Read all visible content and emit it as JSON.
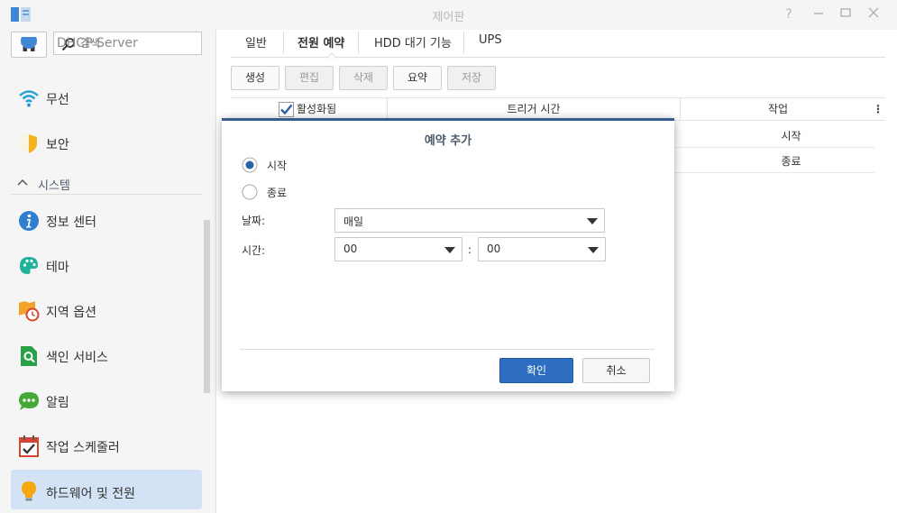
{
  "window": {
    "title": "제어판",
    "controls": [
      "help-icon",
      "minimize-icon",
      "maximize-icon",
      "close-icon"
    ]
  },
  "sidebar": {
    "search_placeholder": "검색",
    "cut_item_label": "DHCP Server",
    "items_top": [
      {
        "label": "무선",
        "icon": "wifi-icon"
      },
      {
        "label": "보안",
        "icon": "shield-icon"
      }
    ],
    "section_label": "시스템",
    "items": [
      {
        "label": "정보 센터",
        "icon": "info-icon"
      },
      {
        "label": "테마",
        "icon": "palette-icon"
      },
      {
        "label": "지역 옵션",
        "icon": "map-clock-icon"
      },
      {
        "label": "색인 서비스",
        "icon": "index-search-icon"
      },
      {
        "label": "알림",
        "icon": "chat-bubble-icon"
      },
      {
        "label": "작업 스케줄러",
        "icon": "calendar-check-icon"
      },
      {
        "label": "하드웨어 및 전원",
        "icon": "lightbulb-icon",
        "active": true
      }
    ]
  },
  "tabs": [
    {
      "label": "일반",
      "active": false
    },
    {
      "label": "전원 예약",
      "active": true
    },
    {
      "label": "HDD 대기 기능",
      "active": false
    },
    {
      "label": "UPS",
      "active": false
    }
  ],
  "toolbar": {
    "create": "생성",
    "edit": "편집",
    "delete": "삭제",
    "summary": "요약",
    "save": "저장"
  },
  "grid": {
    "columns": [
      "활성화됨",
      "트리거 시간",
      "작업"
    ],
    "header_checked": true,
    "rows": [
      {
        "action": "시작"
      },
      {
        "action": "종료"
      }
    ]
  },
  "dialog": {
    "title": "예약 추가",
    "radio_start": "시작",
    "radio_stop": "종료",
    "selected": "시작",
    "date_label": "날짜:",
    "date_value": "매일",
    "time_label": "시간:",
    "hour_value": "00",
    "minute_value": "00",
    "time_separator": ":",
    "ok_label": "확인",
    "cancel_label": "취소"
  },
  "colors": {
    "accent": "#2d6ec0",
    "active_nav": "#d3e3f5",
    "dialog_border": "#395c8c"
  }
}
